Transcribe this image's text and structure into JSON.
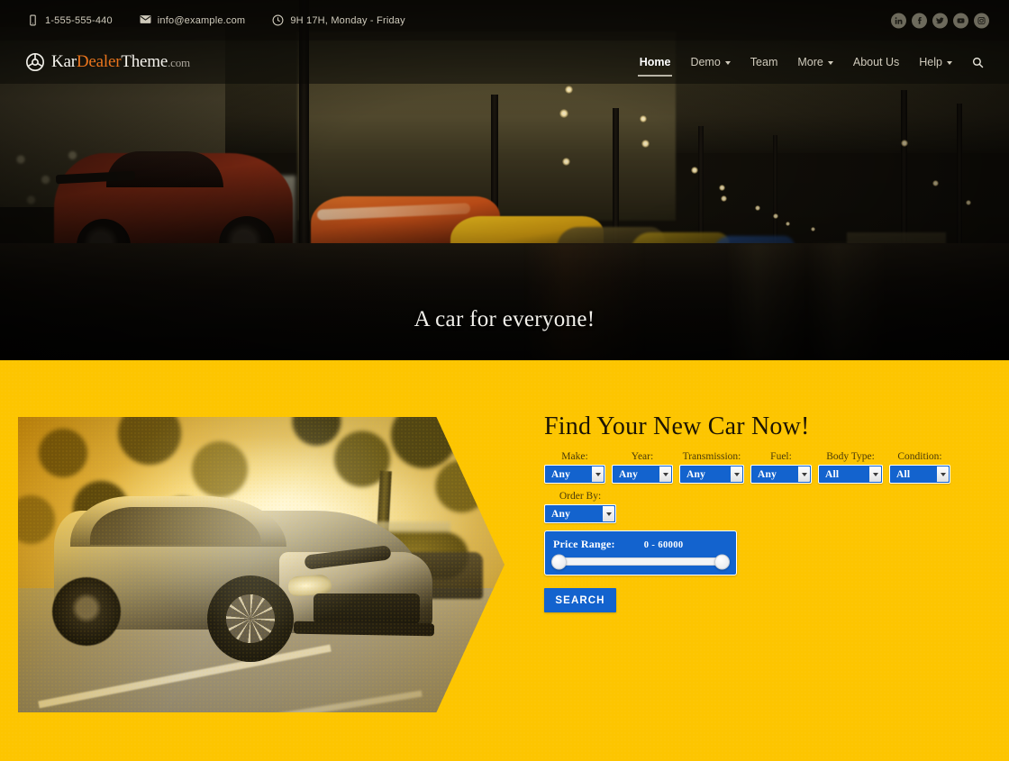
{
  "topbar": {
    "phone": "1-555-555-440",
    "phone_icon": "phone-icon",
    "email": "info@example.com",
    "email_icon": "envelope-icon",
    "hours": "9H 17H, Monday - Friday",
    "hours_icon": "clock-icon",
    "socials": [
      {
        "name": "linkedin-icon",
        "label": "in"
      },
      {
        "name": "facebook-icon",
        "label": "f"
      },
      {
        "name": "twitter-icon",
        "label": "t"
      },
      {
        "name": "youtube-icon",
        "label": "yt"
      },
      {
        "name": "instagram-icon",
        "label": "ig"
      }
    ]
  },
  "header": {
    "logo": {
      "icon": "steering-wheel-icon",
      "part1": "Kar",
      "part2": "Dealer",
      "part3": "Theme",
      "part4": ".com"
    },
    "nav": [
      {
        "label": "Home",
        "active": true,
        "caret": false
      },
      {
        "label": "Demo",
        "active": false,
        "caret": true
      },
      {
        "label": "Team",
        "active": false,
        "caret": false
      },
      {
        "label": "More",
        "active": false,
        "caret": true
      },
      {
        "label": "About Us",
        "active": false,
        "caret": false
      },
      {
        "label": "Help",
        "active": false,
        "caret": true
      }
    ],
    "search_icon": "search-icon"
  },
  "hero": {
    "caption": "A car for everyone!"
  },
  "search_form": {
    "title": "Find Your New Car Now!",
    "fields": [
      {
        "label": "Make:",
        "value": "Any"
      },
      {
        "label": "Year:",
        "value": "Any"
      },
      {
        "label": "Transmission:",
        "value": "Any"
      },
      {
        "label": "Fuel:",
        "value": "Any"
      },
      {
        "label": "Body Type:",
        "value": "All"
      },
      {
        "label": "Condition:",
        "value": "All"
      }
    ],
    "order_by": {
      "label": "Order By:",
      "value": "Any"
    },
    "price_range": {
      "label": "Price Range:",
      "value": "0 - 60000",
      "min": 0,
      "max": 60000
    },
    "submit_label": "SEARCH"
  },
  "colors": {
    "accent_yellow": "#FDC500",
    "blue": "#1363CE",
    "logo_orange": "#E8741D",
    "dark": "#0A0905"
  }
}
